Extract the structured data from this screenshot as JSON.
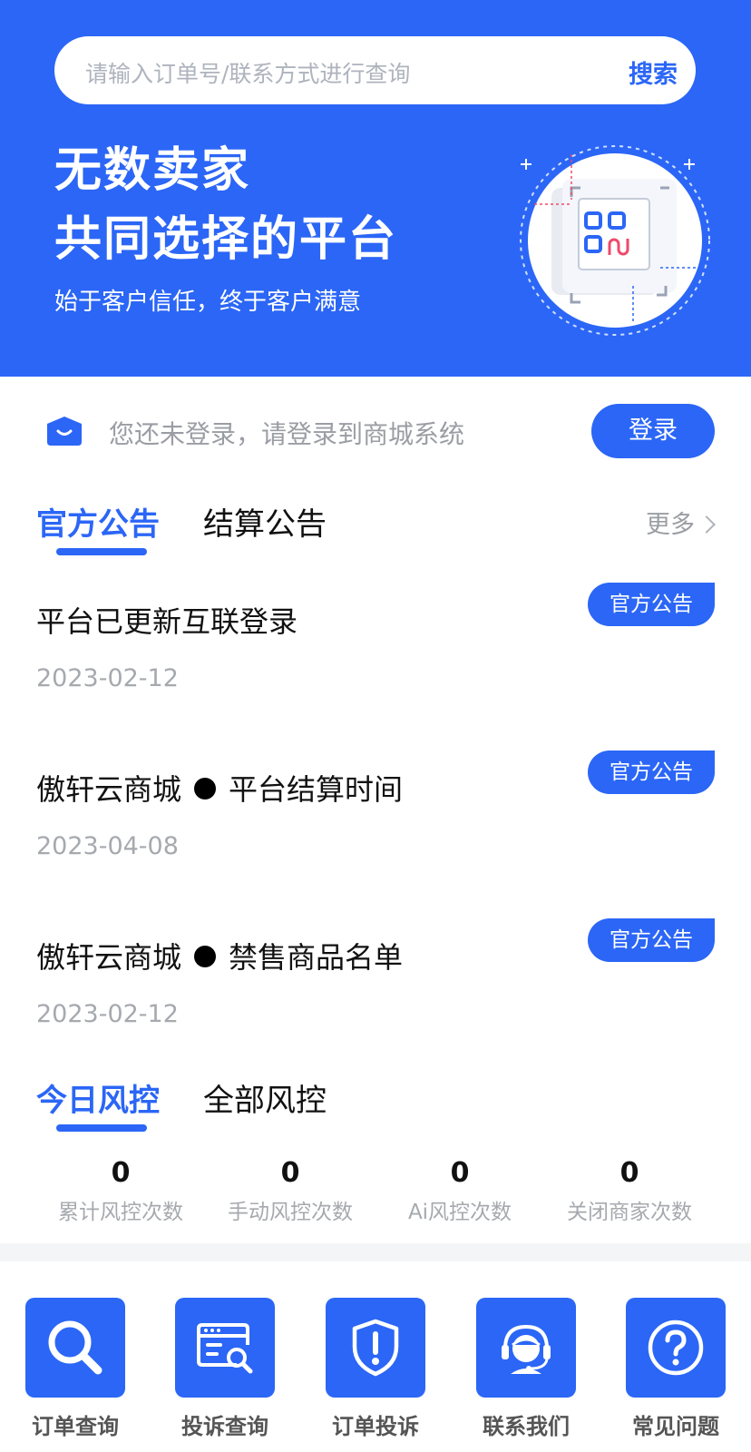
{
  "header": {
    "search_placeholder": "请输入订单号/联系方式进行查询",
    "search_button": "搜索",
    "headline_1": "无数卖家",
    "headline_2": "共同选择的平台",
    "subtitle": "始于客户信任，终于客户满意"
  },
  "login": {
    "message": "您还未登录，请登录到商城系统",
    "button": "登录"
  },
  "announcements": {
    "tabs": [
      "官方公告",
      "结算公告"
    ],
    "more": "更多",
    "items": [
      {
        "title": "平台已更新互联登录",
        "date": "2023-02-12",
        "badge": "官方公告"
      },
      {
        "title_a": "傲轩云商城",
        "title_b": "平台结算时间",
        "date": "2023-04-08",
        "badge": "官方公告"
      },
      {
        "title_a": "傲轩云商城",
        "title_b": "禁售商品名单",
        "date": "2023-02-12",
        "badge": "官方公告"
      }
    ]
  },
  "risk": {
    "tabs": [
      "今日风控",
      "全部风控"
    ],
    "stats": [
      {
        "value": "0",
        "label": "累计风控次数"
      },
      {
        "value": "0",
        "label": "手动风控次数"
      },
      {
        "value": "0",
        "label": "Ai风控次数"
      },
      {
        "value": "0",
        "label": "关闭商家次数"
      }
    ]
  },
  "nav": {
    "items": [
      {
        "label": "订单查询",
        "icon": "search-icon"
      },
      {
        "label": "投诉查询",
        "icon": "browser-search-icon"
      },
      {
        "label": "订单投诉",
        "icon": "shield-alert-icon"
      },
      {
        "label": "联系我们",
        "icon": "headset-icon"
      },
      {
        "label": "常见问题",
        "icon": "question-icon"
      }
    ]
  },
  "colors": {
    "primary": "#2b66f6",
    "muted": "#a6a9ae"
  }
}
